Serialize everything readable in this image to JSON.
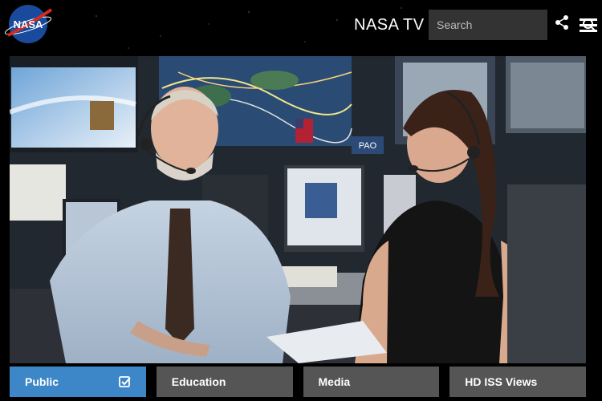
{
  "header": {
    "logo_text": "NASA",
    "brand": "NASA TV",
    "search": {
      "placeholder": "Search"
    },
    "icons": [
      "search-icon",
      "share-icon",
      "menu-icon"
    ]
  },
  "video": {
    "scene": "mission-control-broadcast",
    "screen_label": "PAO"
  },
  "tabs": [
    {
      "label": "Public",
      "active": true
    },
    {
      "label": "Education",
      "active": false
    },
    {
      "label": "Media",
      "active": false
    },
    {
      "label": "HD ISS Views",
      "active": false
    }
  ],
  "colors": {
    "accent": "#3d86c8",
    "tab_inactive": "#555555",
    "background": "#000000"
  }
}
